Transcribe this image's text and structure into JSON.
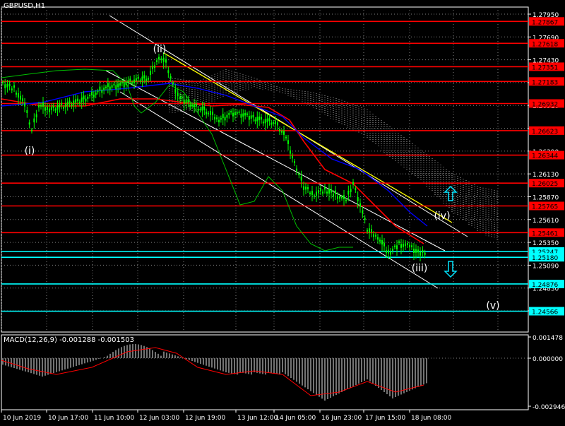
{
  "app": {
    "symbol_label": "GBPUSD,H1",
    "macd_label": "MACD(12,26,9) -0.001288 -0.001503"
  },
  "colors": {
    "background": "#000000",
    "axis": "#ffffff",
    "grid": "#808080",
    "candle": "#00ff00",
    "level_line": "#ff0000",
    "level_badge": "#ff0000",
    "support_line": "#00ffff",
    "support_badge": "#00ffff",
    "yellow_trend": "#ffff00",
    "channel": "#ffffff",
    "ma_red": "#ff0000",
    "ma_blue": "#0000ff",
    "lagging_green": "#00c000",
    "macd_hist": "#c0c0c0",
    "macd_signal": "#ff0000",
    "arrow": "#00e5ff"
  },
  "price_axis": {
    "ticks": [
      "1.27950",
      "1.27690",
      "1.27430",
      "1.27170",
      "1.26910",
      "1.26650",
      "1.26390",
      "1.26130",
      "1.25870",
      "1.25610",
      "1.25350",
      "1.25090",
      "1.24830",
      "1.24570"
    ]
  },
  "levels_red": [
    "1.27867",
    "1.27618",
    "1.27351",
    "1.27183",
    "1.26932",
    "1.26623",
    "1.26344",
    "1.26025",
    "1.25765",
    "1.25461"
  ],
  "levels_cyan": [
    "1.25247",
    "1.25180",
    "1.24876",
    "1.24566"
  ],
  "time_axis": {
    "labels": [
      "10 Jun 2019",
      "10 Jun 17:00",
      "11 Jun 10:00",
      "12 Jun 03:00",
      "12 Jun 19:00",
      "13 Jun 12:00",
      "14 Jun 05:00",
      "16 Jun 23:00",
      "17 Jun 15:00",
      "18 Jun 08:00"
    ]
  },
  "macd_axis": {
    "ticks": [
      "0.001478",
      "0.000000",
      "-0.002946"
    ]
  },
  "wave_labels": {
    "w1": "(i)",
    "w2": "(ii)",
    "w3": "(iii)",
    "w4": "(iv)",
    "w5": "(v)"
  },
  "arrows": {
    "up": "up-arrow",
    "down": "down-arrow"
  }
}
